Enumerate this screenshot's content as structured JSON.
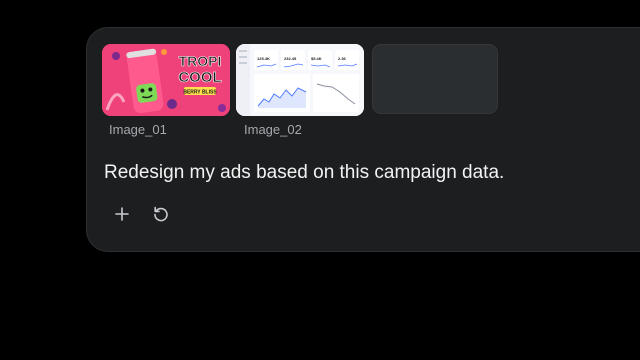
{
  "attachments": [
    {
      "label": "Image_01",
      "brand_word_1": "TROPI",
      "brand_word_2": "COOL",
      "flavor": "BERRY BLISS"
    },
    {
      "label": "Image_02",
      "stats": [
        "125.4K",
        "232.45",
        "$5.4K",
        "2.36"
      ]
    }
  ],
  "composer": {
    "message": "Redesign my ads based on this campaign data."
  },
  "toolbar": {
    "add_icon": "plus-icon",
    "refresh_icon": "refresh-icon"
  },
  "colors": {
    "background": "#000000",
    "panel": "#1c1e20",
    "text": "#f2f2f2",
    "muted": "#a6a9ad",
    "ad_pink": "#f0427a"
  }
}
